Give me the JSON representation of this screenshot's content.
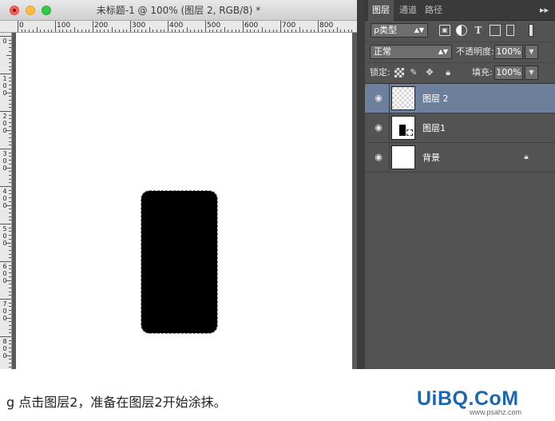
{
  "window": {
    "title": "未标题-1 @ 100% (图层 2, RGB/8) *"
  },
  "rulers": {
    "horizontal": [
      "0",
      "100",
      "200",
      "300",
      "400",
      "500",
      "600",
      "700",
      "800"
    ],
    "vertical": [
      "0",
      "100",
      "200",
      "300",
      "400",
      "500",
      "600",
      "700",
      "800"
    ]
  },
  "panel": {
    "tabs": [
      "图层",
      "通道",
      "路径"
    ],
    "tab_menu": "▸▸",
    "filter": {
      "label": "ρ类型"
    },
    "blend": {
      "mode": "正常",
      "opacity_label": "不透明度:",
      "opacity": "100%"
    },
    "lock": {
      "label": "锁定:",
      "fill_label": "填充:",
      "fill": "100%"
    },
    "layers": [
      {
        "name": "图层 2",
        "selected": true,
        "thumb": "transparent"
      },
      {
        "name": "图层1",
        "selected": false,
        "thumb": "shape"
      },
      {
        "name": "背景",
        "selected": false,
        "thumb": "white",
        "locked": true
      }
    ]
  },
  "caption": "g 点击图层2，准备在图层2开始涂抹。",
  "watermark": {
    "main": "UiBQ.CoM",
    "sub": "www.psahz.com"
  },
  "colors": {
    "selected_layer": "#6d7f9a",
    "panel_bg": "#535353",
    "shape_fill": "#000000",
    "watermark": "#1e67a8"
  }
}
